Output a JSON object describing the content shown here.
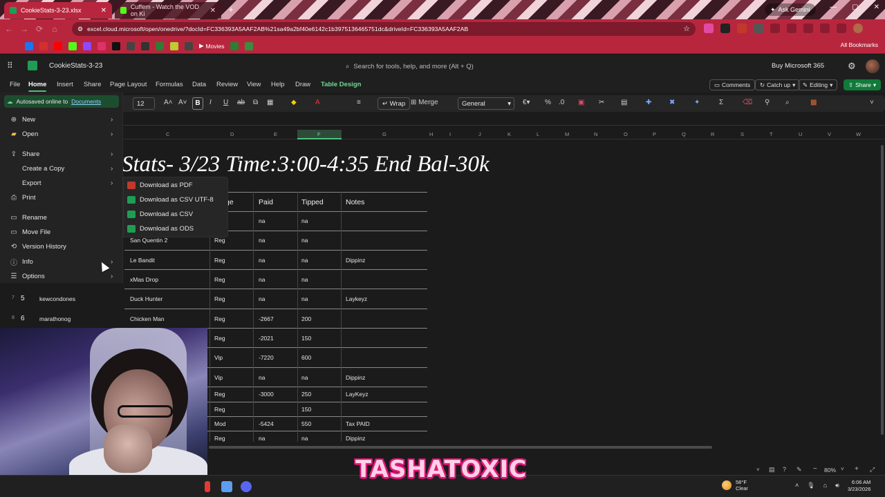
{
  "browser": {
    "tabs": [
      {
        "title": "CookieStats-3-23.xlsx",
        "active": true
      },
      {
        "title": "Cuffem - Watch the VOD on Ki",
        "active": false
      }
    ],
    "ask_gemini": "Ask Gemini",
    "url": "excel.cloud.microsoft/open/onedrive/?docId=FC336393A5AAF2AB%21sa49a2bf40e6142c1b3975136465751dc&driveId=FC336393A5AAF2AB",
    "bookmarks": {
      "movies": "Movies",
      "all": "All Bookmarks"
    },
    "accent": "#b8263e"
  },
  "excel": {
    "doc_name": "CookieStats-3-23",
    "search_placeholder": "Search for tools, help, and more (Alt + Q)",
    "buy": "Buy Microsoft 365",
    "ribbon_tabs": [
      "File",
      "Home",
      "Insert",
      "Share",
      "Page Layout",
      "Formulas",
      "Data",
      "Review",
      "View",
      "Help",
      "Draw",
      "Table Design"
    ],
    "ribbon_buttons": {
      "comments": "Comments",
      "catch_up": "Catch up",
      "editing": "Editing",
      "share": "Share"
    },
    "toolbar": {
      "font_size": "12",
      "wrap": "Wrap",
      "merge": "Merge",
      "number_format": "General"
    },
    "columns": [
      "C",
      "D",
      "E",
      "F",
      "G",
      "H",
      "I",
      "J",
      "K",
      "L",
      "M",
      "N",
      "O",
      "P",
      "Q",
      "R",
      "S",
      "T",
      "U",
      "V",
      "W"
    ],
    "zoom": "80%"
  },
  "file_menu": {
    "autosave_prefix": "Autosaved online to",
    "autosave_link": "Documents",
    "items": [
      {
        "label": "New",
        "icon": "new-icon",
        "glyph": "⊕",
        "has_submenu": true
      },
      {
        "label": "Open",
        "icon": "folder-icon",
        "glyph": "▰",
        "has_submenu": true
      },
      {
        "label": "Share",
        "icon": "share-icon",
        "glyph": "⇪",
        "has_submenu": true
      },
      {
        "label": "Create a Copy",
        "icon": "copy-icon",
        "glyph": "",
        "has_submenu": true
      },
      {
        "label": "Export",
        "icon": "export-icon",
        "glyph": "",
        "has_submenu": true
      },
      {
        "label": "Print",
        "icon": "print-icon",
        "glyph": "⎙",
        "has_submenu": false
      },
      {
        "label": "Rename",
        "icon": "rename-icon",
        "glyph": "▭",
        "has_submenu": false
      },
      {
        "label": "Move File",
        "icon": "move-file-icon",
        "glyph": "▭",
        "has_submenu": false
      },
      {
        "label": "Version History",
        "icon": "history-icon",
        "glyph": "⟲",
        "has_submenu": false
      },
      {
        "label": "Info",
        "icon": "info-icon",
        "glyph": "ⓘ",
        "has_submenu": true
      },
      {
        "label": "Options",
        "icon": "options-icon",
        "glyph": "☰",
        "has_submenu": true
      }
    ],
    "export_submenu": [
      {
        "label": "Download as PDF",
        "icon": "pdf-icon"
      },
      {
        "label": "Download as CSV UTF-8",
        "icon": "csv-utf8-icon"
      },
      {
        "label": "Download as CSV",
        "icon": "csv-icon"
      },
      {
        "label": "Download as ODS",
        "icon": "ods-icon"
      }
    ]
  },
  "sheet": {
    "title": "Stats- 3/23 Time:3:00-4:35 End Bal-30k",
    "headers": {
      "col_d_partial": "ge",
      "paid": "Paid",
      "tipped": "Tipped",
      "notes": "Notes"
    },
    "rows": [
      {
        "rownum": "",
        "idx": "",
        "name": "",
        "slot": "",
        "type": "",
        "paid": "na",
        "tipped": "na",
        "notes": ""
      },
      {
        "rownum": "",
        "idx": "",
        "name": "",
        "slot": "San Quentin 2",
        "type": "Reg",
        "paid": "na",
        "tipped": "na",
        "notes": ""
      },
      {
        "rownum": "",
        "idx": "",
        "name": "",
        "slot": "Le Bandit",
        "type": "Reg",
        "paid": "na",
        "tipped": "na",
        "notes": "Dippinz"
      },
      {
        "rownum": "",
        "idx": "",
        "name": "",
        "slot": "xMas Drop",
        "type": "Reg",
        "paid": "na",
        "tipped": "na",
        "notes": ""
      },
      {
        "rownum": "7",
        "idx": "5",
        "name": "kewcondones",
        "slot": "Duck Hunter",
        "type": "Reg",
        "paid": "na",
        "tipped": "na",
        "notes": "Laykeyz"
      },
      {
        "rownum": "8",
        "idx": "6",
        "name": "marathonog",
        "slot": "Chicken Man",
        "type": "Reg",
        "paid": "-2667",
        "tipped": "200",
        "notes": ""
      },
      {
        "rownum": "",
        "idx": "",
        "name": "",
        "slot": "",
        "type": "Reg",
        "paid": "-2021",
        "tipped": "150",
        "notes": ""
      },
      {
        "rownum": "",
        "idx": "",
        "name": "",
        "slot": "",
        "type": "Vip",
        "paid": "-7220",
        "tipped": "600",
        "notes": ""
      },
      {
        "rownum": "",
        "idx": "",
        "name": "",
        "slot": "",
        "type": "Vip",
        "paid": "na",
        "tipped": "na",
        "notes": "Dippinz"
      },
      {
        "rownum": "",
        "idx": "",
        "name": "",
        "slot": "",
        "type": "Reg",
        "paid": "-3000",
        "tipped": "250",
        "notes": "LayKeyz"
      },
      {
        "rownum": "",
        "idx": "",
        "name": "",
        "slot": "",
        "type": "Reg",
        "paid": "",
        "tipped": "150",
        "notes": ""
      },
      {
        "rownum": "",
        "idx": "",
        "name": "",
        "slot": "",
        "type": "Mod",
        "paid": "-5424",
        "tipped": "550",
        "notes": "Tax PAID"
      },
      {
        "rownum": "",
        "idx": "",
        "name": "",
        "slot": "",
        "type": "Reg",
        "paid": "na",
        "tipped": "na",
        "notes": "Dippinz"
      }
    ]
  },
  "taskbar": {
    "weather_temp": "58°F",
    "weather_cond": "Clear",
    "time": "6:06 AM",
    "date": "3/23/2026"
  },
  "overlay": {
    "brand": "TASHATOXIC"
  }
}
